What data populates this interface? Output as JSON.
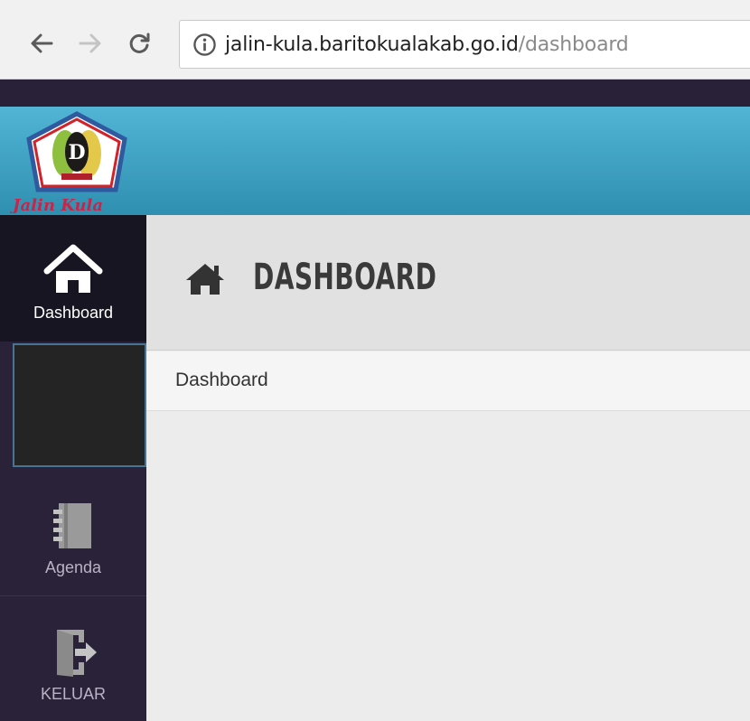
{
  "browser": {
    "url_host": "jalin-kula.baritokualakab.go.id",
    "url_path": "/dashboard"
  },
  "header": {
    "logo_text": "Jalin Kula"
  },
  "sidebar": {
    "items": [
      {
        "label": "Dashboard",
        "icon": "home-icon",
        "active": true
      },
      {
        "label": "",
        "icon": "",
        "active": false
      },
      {
        "label": "Agenda",
        "icon": "notebook-icon",
        "active": false
      },
      {
        "label": "KELUAR",
        "icon": "logout-icon",
        "active": false
      }
    ]
  },
  "main": {
    "title": "DASHBOARD",
    "title_icon": "home-icon",
    "breadcrumb": "Dashboard"
  },
  "colors": {
    "header_top": "#52b5d5",
    "header_bottom": "#2f8fb1",
    "sidebar": "#2a2238",
    "sidebar_active": "#171521",
    "content_bg": "#ececec"
  }
}
